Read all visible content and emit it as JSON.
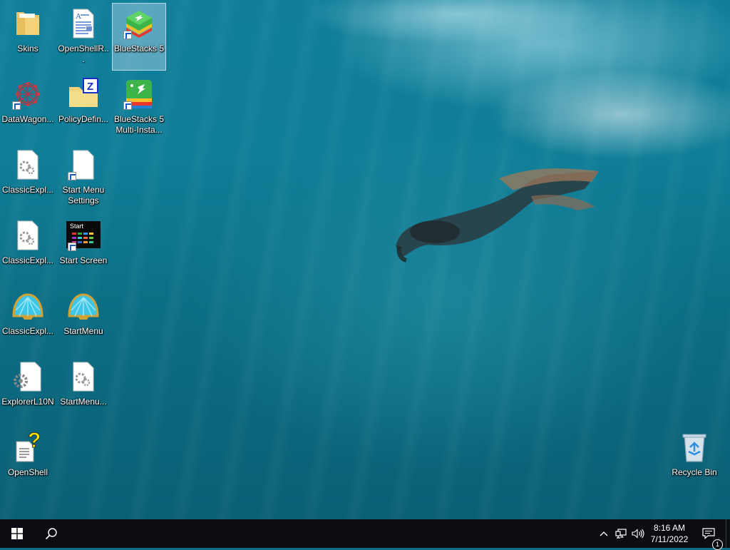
{
  "desktop": {
    "icons": [
      {
        "label": "Skins",
        "icon": "folder-icon",
        "shortcut": false
      },
      {
        "label": "OpenShellR...",
        "icon": "document-icon",
        "shortcut": false
      },
      {
        "label": "BlueStacks 5",
        "icon": "bluestacks-icon",
        "shortcut": true,
        "selected": true
      },
      {
        "label": "DataWagon...",
        "icon": "network-graph-icon",
        "shortcut": true
      },
      {
        "label": "PolicyDefin...",
        "icon": "zipped-folder-icon",
        "shortcut": false
      },
      {
        "label": "BlueStacks 5 Multi-Insta...",
        "icon": "bluestacks-multi-instance-icon",
        "shortcut": true
      },
      {
        "label": "ClassicExpl...",
        "icon": "settings-file-icon",
        "shortcut": false
      },
      {
        "label": "Start Menu Settings",
        "icon": "blank-file-icon",
        "shortcut": true
      },
      {
        "label": "ClassicExpl...",
        "icon": "settings-file-icon",
        "shortcut": false
      },
      {
        "label": "Start Screen",
        "icon": "start-screen-icon",
        "shortcut": true
      },
      {
        "label": "ClassicExpl...",
        "icon": "shell-icon",
        "shortcut": false
      },
      {
        "label": "StartMenu",
        "icon": "shell-icon",
        "shortcut": false
      },
      {
        "label": "ExplorerL10N",
        "icon": "settings-file-icon",
        "shortcut": false
      },
      {
        "label": "StartMenu...",
        "icon": "settings-file-icon",
        "shortcut": false
      },
      {
        "label": "OpenShell",
        "icon": "help-file-icon",
        "shortcut": false
      },
      {
        "label": "Recycle Bin",
        "icon": "recycle-bin-icon",
        "shortcut": false
      }
    ],
    "start_screen_thumb_text": "Start"
  },
  "taskbar": {
    "start_icon": "windows-logo-icon",
    "search_icon": "search-icon",
    "tray": {
      "chevron_icon": "chevron-up-icon",
      "network_icon": "network-icon",
      "volume_icon": "volume-icon"
    },
    "clock": {
      "time": "8:16 AM",
      "date": "7/11/2022"
    },
    "notifications": {
      "icon": "action-center-icon",
      "count": "1"
    }
  }
}
